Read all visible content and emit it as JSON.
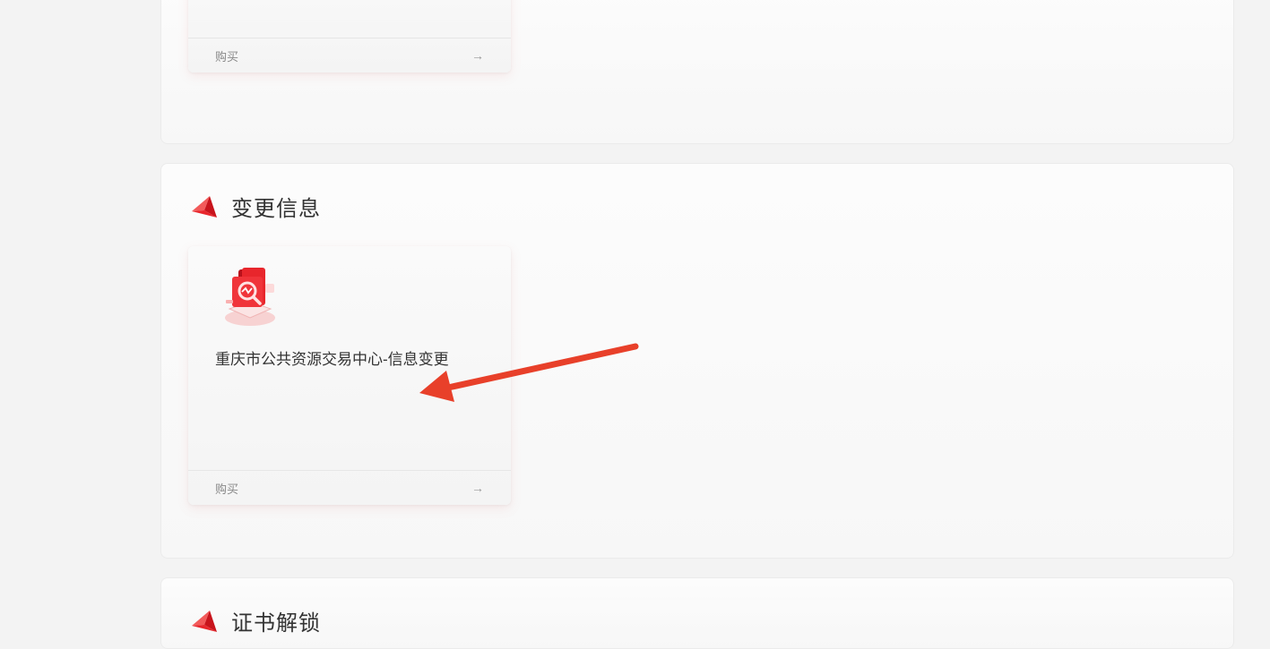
{
  "sections": [
    {
      "title": "",
      "card": {
        "buy_label": "购买",
        "arrow": "→"
      }
    },
    {
      "title": "变更信息",
      "card": {
        "icon": "book-search-icon",
        "product_name": "重庆市公共资源交易中心-信息变更",
        "buy_label": "购买",
        "arrow": "→"
      }
    },
    {
      "title": "证书解锁"
    }
  ],
  "colors": {
    "accent_red": "#e8262c",
    "annotation_arrow": "#e8402a",
    "page_bg": "#f3f3f3"
  }
}
